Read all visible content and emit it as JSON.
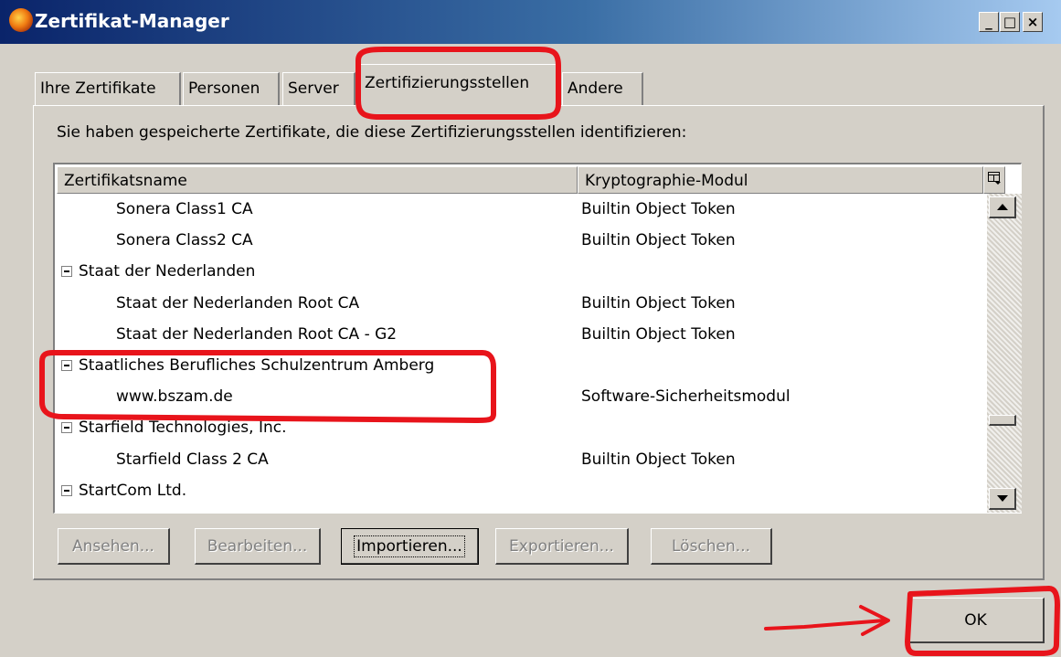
{
  "window": {
    "title": "Zertifikat-Manager",
    "controls": {
      "minimize": "_",
      "maximize": "□",
      "close": "×"
    }
  },
  "tabs": [
    {
      "label": "Ihre Zertifikate",
      "active": false
    },
    {
      "label": "Personen",
      "active": false
    },
    {
      "label": "Server",
      "active": false
    },
    {
      "label": "Zertifizierungsstellen",
      "active": true
    },
    {
      "label": "Andere",
      "active": false
    }
  ],
  "intro_text": "Sie haben gespeicherte Zertifikate, die diese Zertifizierungsstellen identifizieren:",
  "table": {
    "columns": [
      "Zertifikatsname",
      "Kryptographie-Modul"
    ],
    "column_picker_icon": "column-picker-icon",
    "rows": [
      {
        "type": "child",
        "name": "Sonera Class1 CA",
        "module": "Builtin Object Token"
      },
      {
        "type": "child",
        "name": "Sonera Class2 CA",
        "module": "Builtin Object Token"
      },
      {
        "type": "group",
        "name": "Staat der Nederlanden",
        "module": ""
      },
      {
        "type": "child",
        "name": "Staat der Nederlanden Root CA",
        "module": "Builtin Object Token"
      },
      {
        "type": "child",
        "name": "Staat der Nederlanden Root CA - G2",
        "module": "Builtin Object Token"
      },
      {
        "type": "group",
        "name": "Staatliches Berufliches Schulzentrum Amberg",
        "module": ""
      },
      {
        "type": "child",
        "name": "www.bszam.de",
        "module": "Software-Sicherheitsmodul"
      },
      {
        "type": "group",
        "name": "Starfield Technologies, Inc.",
        "module": ""
      },
      {
        "type": "child",
        "name": "Starfield Class 2 CA",
        "module": "Builtin Object Token"
      },
      {
        "type": "group",
        "name": "StartCom Ltd.",
        "module": ""
      }
    ]
  },
  "buttons": {
    "view": "Ansehen...",
    "edit": "Bearbeiten...",
    "import": "Importieren...",
    "export": "Exportieren...",
    "delete": "Löschen...",
    "ok": "OK"
  },
  "colors": {
    "annotation_red": "#e8141b",
    "titlebar_start": "#0a246a",
    "titlebar_end": "#a6caf0",
    "dialog_bg": "#d4d0c8"
  }
}
